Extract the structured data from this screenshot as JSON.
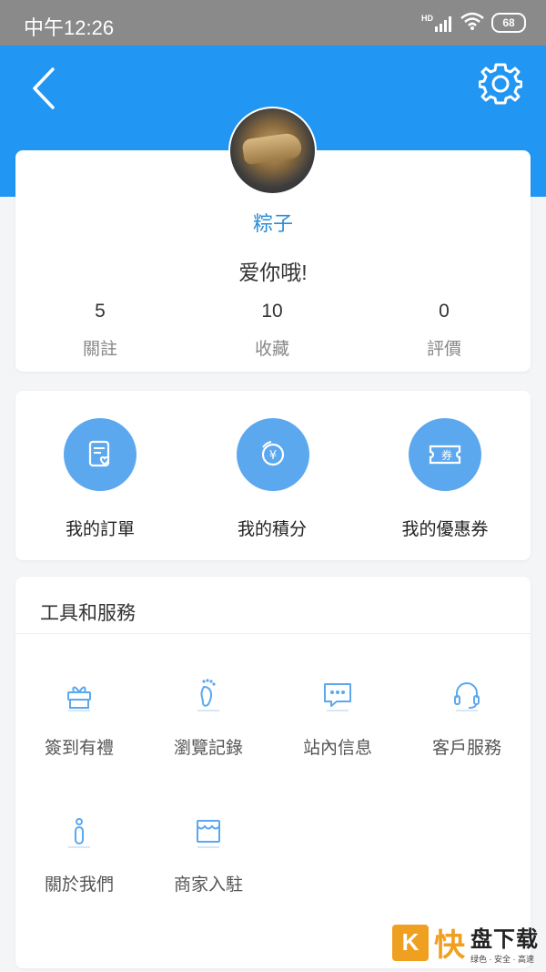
{
  "status_bar": {
    "time": "中午12:26",
    "network": "HD",
    "battery": "68"
  },
  "profile": {
    "name": "粽子",
    "signature": "爱你哦!",
    "stats": [
      {
        "value": "5",
        "label": "關註"
      },
      {
        "value": "10",
        "label": "收藏"
      },
      {
        "value": "0",
        "label": "評價"
      }
    ]
  },
  "orders": [
    {
      "label": "我的訂單",
      "icon": "order-icon"
    },
    {
      "label": "我的積分",
      "icon": "points-icon"
    },
    {
      "label": "我的優惠券",
      "icon": "coupon-icon"
    }
  ],
  "tools": {
    "title": "工具和服務",
    "items": [
      {
        "label": "簽到有禮",
        "icon": "gift-icon"
      },
      {
        "label": "瀏覽記錄",
        "icon": "footprint-icon"
      },
      {
        "label": "站內信息",
        "icon": "message-icon"
      },
      {
        "label": "客戶服務",
        "icon": "headset-icon"
      },
      {
        "label": "關於我們",
        "icon": "info-icon"
      },
      {
        "label": "商家入駐",
        "icon": "store-icon"
      }
    ]
  },
  "watermark": {
    "logo_letter": "K",
    "logo_char": "快",
    "main": "盘下载",
    "sub": "绿色 · 安全 · 高速"
  },
  "colors": {
    "header": "#2196f3",
    "accent": "#5ba8ef",
    "name": "#2a8ed6"
  }
}
